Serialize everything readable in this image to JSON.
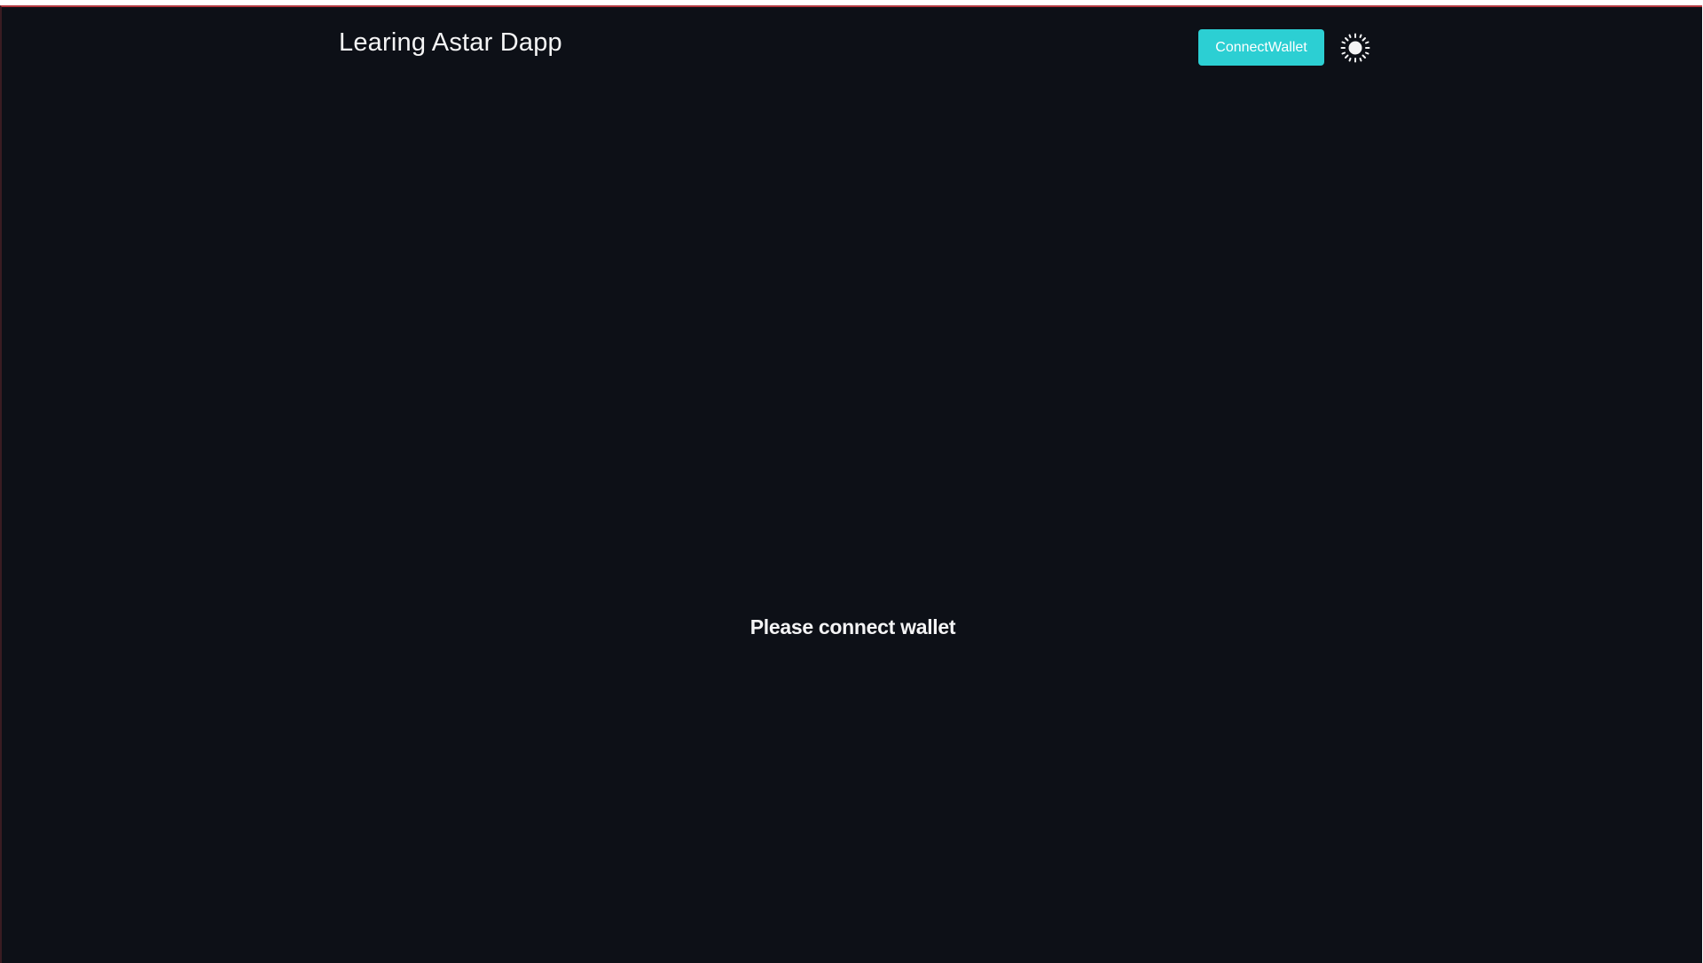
{
  "header": {
    "title": "Learing Astar Dapp",
    "connect_button_label": "ConnectWallet",
    "theme_toggle_icon": "sun-icon"
  },
  "main": {
    "empty_message": "Please connect wallet"
  },
  "colors": {
    "background": "#0d1017",
    "accent": "#2ccfd3",
    "text": "#f4f4f5"
  }
}
